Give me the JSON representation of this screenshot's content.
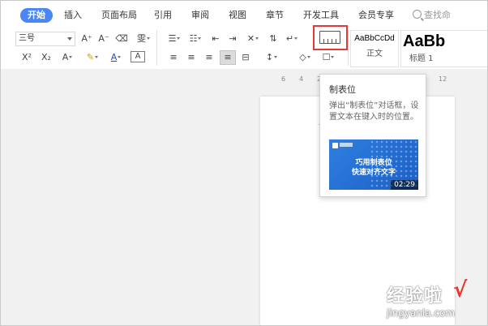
{
  "tabs": [
    {
      "label": "开始",
      "active": true
    },
    {
      "label": "插入"
    },
    {
      "label": "页面布局"
    },
    {
      "label": "引用"
    },
    {
      "label": "审阅"
    },
    {
      "label": "视图"
    },
    {
      "label": "章节"
    },
    {
      "label": "开发工具"
    },
    {
      "label": "会员专享"
    }
  ],
  "search": {
    "label": "查找命"
  },
  "ribbon": {
    "font_size": "三号",
    "grow_font": "A⁺",
    "shrink_font": "A⁻",
    "clear_format": "⌫",
    "phonetic": "雯",
    "superscript": "X²",
    "subscript": "X₂",
    "text_effect": "A",
    "highlight": "✎",
    "font_color": "A",
    "char_border": "A",
    "styles": [
      {
        "sample": "AaBbCcDd",
        "name": "正文"
      },
      {
        "sample": "AaBb",
        "name": "标题 1"
      }
    ]
  },
  "ruler": [
    "6",
    "4",
    "2",
    "",
    "10",
    "12"
  ],
  "tooltip": {
    "title": "制表位",
    "description": "弹出“制表位”对话框，设置文本在键入时的位置。",
    "video_line1": "巧用制表位",
    "video_line2": "快速对齐文字",
    "duration": "02:29"
  },
  "watermark": {
    "line1": "经验啦",
    "check": "√",
    "line2": "jingyanla.com"
  },
  "colors": {
    "accent": "#4a86f5",
    "highlight_border": "#e53935",
    "video_bg": "#2f7fe0"
  }
}
